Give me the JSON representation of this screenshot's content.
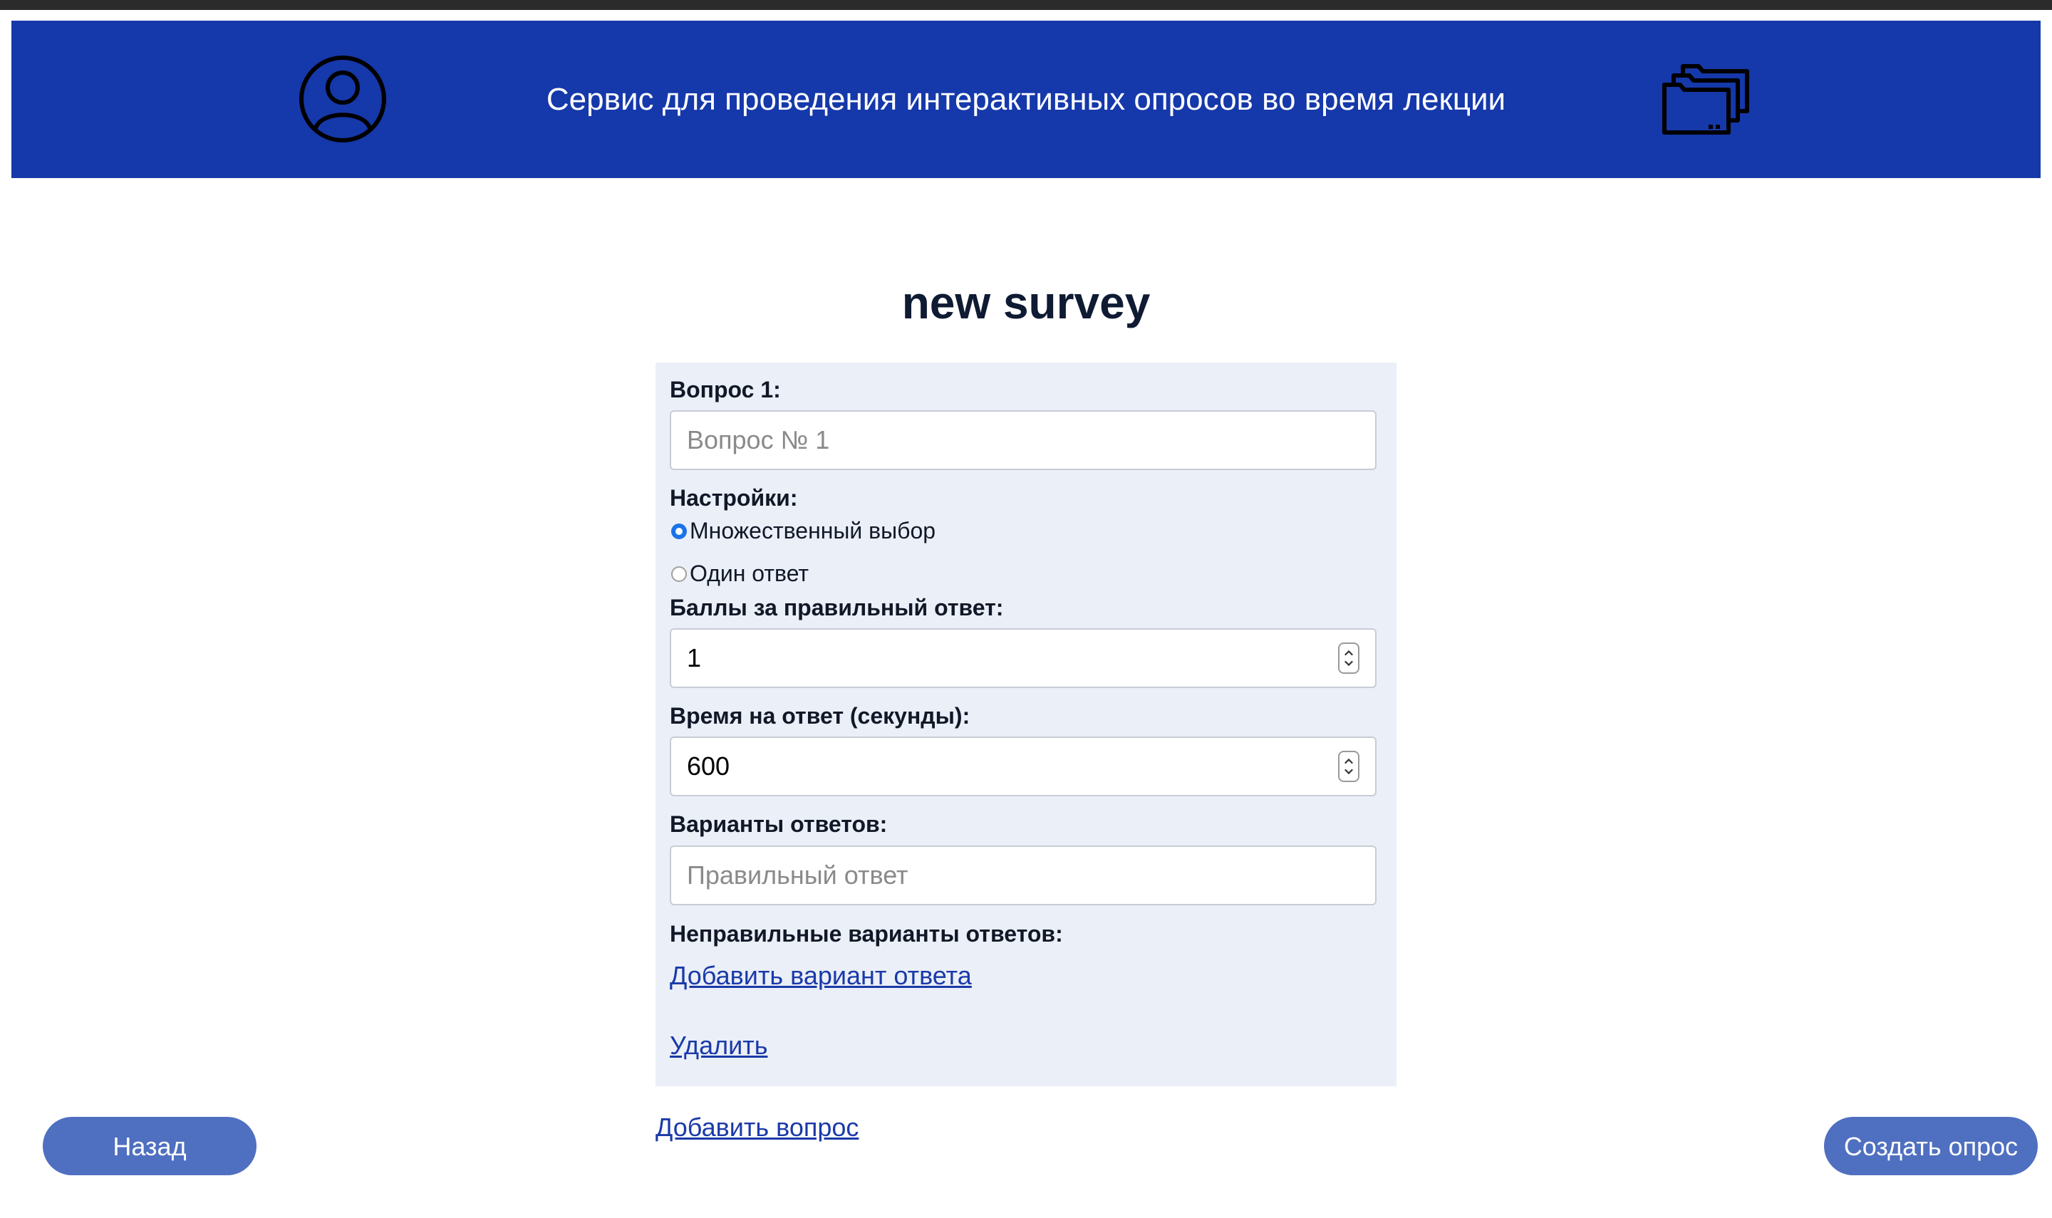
{
  "header": {
    "title": "Сервис для проведения интерактивных опросов во время лекции",
    "user_icon": "user-circle-icon",
    "folder_icon": "folders-icon",
    "background": "#1538aa"
  },
  "page": {
    "title": "new survey"
  },
  "question": {
    "label": "Вопрос 1:",
    "placeholder": "Вопрос № 1",
    "value": "",
    "settings_label": "Настройки:",
    "options": [
      {
        "label": "Множественный выбор",
        "selected": true
      },
      {
        "label": "Один ответ",
        "selected": false
      }
    ],
    "points_label": "Баллы за правильный ответ:",
    "points_value": "1",
    "time_label": "Время на ответ (секунды):",
    "time_value": "600",
    "answers_label": "Варианты ответов:",
    "correct_placeholder": "Правильный ответ",
    "wrong_label": "Неправильные варианты ответов:",
    "add_option_link": "Добавить вариант ответа",
    "delete_link": "Удалить"
  },
  "add_question_link": "Добавить вопрос",
  "buttons": {
    "back": "Назад",
    "create": "Создать опрос"
  },
  "colors": {
    "button": "#4f6fc0",
    "card": "#ebeff7",
    "link": "#1a3aa8",
    "accent": "#1a73e8"
  }
}
